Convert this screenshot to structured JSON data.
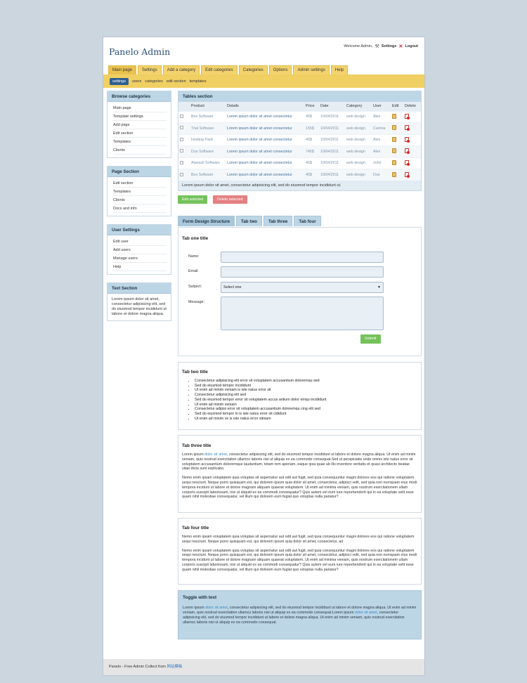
{
  "brand": "Panelo Admin",
  "topbar": {
    "welcome": "Welcome Admin,",
    "settings": "Settings",
    "logout": "Logout"
  },
  "main_tabs": [
    "Main page",
    "Settings",
    "Add a category",
    "Edit categories",
    "Categories",
    "Options",
    "Admin settings",
    "Help"
  ],
  "sub_tabs": [
    "settings",
    "users",
    "categories",
    "edit section",
    "templates"
  ],
  "sidebar": {
    "browse": {
      "title": "Browse categories",
      "items": [
        "Main page",
        "Template settings",
        "Add page",
        "Edit section",
        "Templates",
        "Clients"
      ]
    },
    "page": {
      "title": "Page Section",
      "items": [
        "Edit section",
        "Templates",
        "Clients",
        "Docs and info"
      ]
    },
    "user": {
      "title": "User Settings",
      "items": [
        "Edit user",
        "Add users",
        "Manage users",
        "Help"
      ]
    },
    "text": {
      "title": "Text Section",
      "body": "Lorem ipsum dolor sit amet, consectetur adipisicing elit, sed do eiusmod tempor incididunt ut labore et dolore magna aliqua."
    }
  },
  "tables": {
    "title": "Tables section",
    "headers": [
      "",
      "Product",
      "Details",
      "Price",
      "Date",
      "Category",
      "User",
      "Edit",
      "Delete"
    ],
    "rows": [
      [
        "Box Software",
        "Lorem ipsum dolor sit amet consectetur",
        "45$",
        "10/04/2011",
        "web design",
        "Alex"
      ],
      [
        "Trial Software",
        "Lorem ipsum dolor sit amet consectetur",
        "155$",
        "10/04/2011",
        "web design",
        "Carrina"
      ],
      [
        "Hosting Pack",
        "Lorem ipsum dolor sit amet consectetur",
        "45$",
        "10/04/2011",
        "web design",
        "Alex"
      ],
      [
        "Duo Software",
        "Lorem ipsum dolor sit amet consectetur",
        "745$",
        "10/04/2011",
        "web design",
        "Alex"
      ],
      [
        "Alavasti Software",
        "Lorem ipsum dolor sit amet consectetur",
        "45$",
        "10/04/2011",
        "web design",
        "John"
      ],
      [
        "Box Software",
        "Lorem ipsum dolor sit amet consectetur",
        "45$",
        "10/04/2011",
        "web design",
        "Doe"
      ]
    ],
    "footer": "Lorem ipsum dolor sit amet, consectetur adipisicing elit, sed do eiusmod tempor incididunt ut.",
    "edit_selected": "Edit selected",
    "delete_selected": "Delete selected"
  },
  "form_tabs": [
    "Form Design Structure",
    "Tab two",
    "Tab three",
    "Tab four"
  ],
  "form": {
    "title": "Tab one title",
    "name_label": "Name:",
    "email_label": "Email:",
    "subject_label": "Subject:",
    "subject_value": "Select one",
    "message_label": "Message:",
    "submit": "Submit"
  },
  "tab_two": {
    "title": "Tab two title",
    "items": [
      "Consectetur adipisicing elit error sit voluptatem accusantium doloremqu sed",
      "Sed do eiusmod tempor incididunt",
      "Ut enim ad minim veniam is iste natus error sit",
      "Consectetur adipisicing elit sed",
      "Sed do eiusmod tempor error sit voluptatem accus antium dolor emqu incididunt",
      "Ut enim ad minim veniam",
      "Consectetur adipisi error sit voluptatem accusantium doloremqu cing elit sed",
      "Sed do eiusmod tempor in is iste natus error sit cididunt",
      "Ut enim ad minim ve is iste natus error sitniam"
    ]
  },
  "tab_three": {
    "title": "Tab three title",
    "p1_a": "Lorem ipsum ",
    "p1_link": "dolor sit amet",
    "p1_b": ", consectetur adipisicing elit, sed do eiusmod tempor incididunt ut labore et dolore magna aliqua. Ut enim ad minim veniam, quis nostrud exercitation ullamco laboris nisi ut aliquip ex ea commodo consequat.Sed ut perspiciatis unde omnis iste natus error sit voluptatem accusantium doloremque laudantium, totam rem aperiam, eaque ipsa quae ab illo inventore veritatis et quasi architecto beatae vitae dicta sunt explicabo.",
    "p2": "Nemo enim ipsam voluptatem quia voluptas sit aspernatur aut odit aut fugit, sed quia consequuntur magni dolores eos qui ratione voluptatem sequi nesciunt. Neque porro quisquam est, qui dolorem ipsum quia dolor sit amet, consectetur, adipisci velit, sed quia non numquam eius modi tempora incidunt ut labore et dolore magnam aliquam quaerat voluptatem. Ut enim ad minima veniam, quis nostrum exercitationem ullam corporis suscipit laboriosam, nisi ut aliquid ex ea commodi consequatur? Quis autem vel eum iure reprehenderit qui in ea voluptate velit esse quam nihil molestiae consequatur, vel illum qui dolorem eum fugiat quo voluptas nulla pariatur?"
  },
  "tab_four": {
    "title": "Tab four title",
    "p1": "Nemo enim ipsam voluptatem quia voluptas sit aspernatur aut odit aut fugit, sed quia consequuntur magni dolores eos qui ratione voluptatem sequi nesciunt. Neque porro quisquam est, qui dolorem ipsum quia dolor sit amet, consectetur, ad",
    "p2": "Nemo enim ipsam voluptatem quia voluptas sit aspernatur aut odit aut fugit, sed quia consequuntur magni dolores eos qui ratione voluptatem sequi nesciunt. Neque porro quisquam est, qui dolorem ipsum quia dolor sit amet, consectetur, adipisci velit, sed quia non numquam eius modi tempora incidunt ut labore et dolore magnam aliquam quaerat voluptatem. Ut enim ad minima veniam, quis nostrum exercitationem ullam corporis suscipit laboriosam, nisi ut aliquid ex ea commodi consequatur? Quis autem vel eum iure reprehenderit qui in ea voluptate velit esse quam nihil molestiae consequatur, vel illum qui dolorem eum fugiat quo voluptas nulla pariatur?"
  },
  "toggle": {
    "title": "Toggle with text",
    "a": "Lorem ipsum ",
    "link1": "dolor sit amet",
    "b": ", consectetur adipisicing elit, sed do eiusmod tempor incididunt ut labore et dolore magna aliqua. Ut enim ad minim veniam, quis nostrud exercitation ullamco laboris nisi ut aliquip ex ea commodo consequat.Lorem ipsum ",
    "link2": "dolor sit amet",
    "c": ", consectetur adipisicing elit, sed do eiusmod tempor incididunt ut labore et dolore magna aliqua. Ut enim ad minim veniam, quis nostrud exercitation ullamco laboris nisi ut aliquip ex ea commodo consequat."
  },
  "footer": {
    "text": "Panelo - Free Admin Collect from ",
    "link": "网站模板"
  }
}
